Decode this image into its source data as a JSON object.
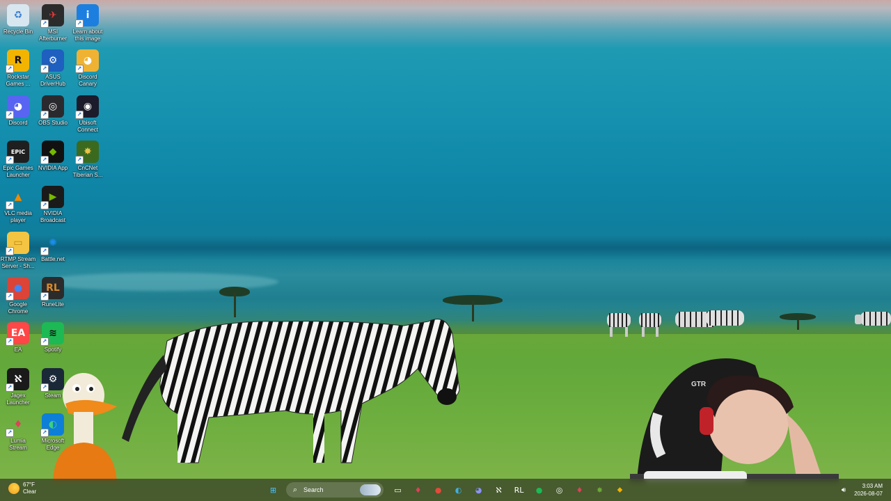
{
  "desktop": {
    "icons": [
      {
        "name": "recycle-bin",
        "label": "Recycle Bin",
        "glyph": "♻",
        "bg": "#d8e6f0",
        "fg": "#3b7fd0"
      },
      {
        "name": "msi-afterburner",
        "label": "MSI\nAfterburner",
        "glyph": "✈",
        "bg": "#2b2b2b",
        "fg": "#e23b3b"
      },
      {
        "name": "learn-about-image",
        "label": "Learn about\nthis image",
        "glyph": "i",
        "bg": "#1c7fe0",
        "fg": "#ffffff"
      },
      {
        "name": "rockstar-games",
        "label": "Rockstar\nGames ...",
        "glyph": "R",
        "bg": "#f2b400",
        "fg": "#111111"
      },
      {
        "name": "asus-driverhub",
        "label": "ASUS\nDriverHub",
        "glyph": "⚙",
        "bg": "#1e5fbf",
        "fg": "#ffffff"
      },
      {
        "name": "discord-canary",
        "label": "Discord\nCanary",
        "glyph": "◕",
        "bg": "#f0b232",
        "fg": "#ffffff"
      },
      {
        "name": "discord",
        "label": "Discord",
        "glyph": "◕",
        "bg": "#5865f2",
        "fg": "#ffffff"
      },
      {
        "name": "obs-studio",
        "label": "OBS Studio",
        "glyph": "◎",
        "bg": "#2a2a2e",
        "fg": "#ffffff"
      },
      {
        "name": "ubisoft-connect",
        "label": "Ubisoft\nConnect",
        "glyph": "◉",
        "bg": "#1b1b2b",
        "fg": "#ffffff"
      },
      {
        "name": "epic-games",
        "label": "Epic Games\nLauncher",
        "glyph": "EPIC",
        "bg": "#1f1f1f",
        "fg": "#ffffff"
      },
      {
        "name": "nvidia-app",
        "label": "NVIDIA App",
        "glyph": "◆",
        "bg": "#111111",
        "fg": "#76b900"
      },
      {
        "name": "cncnet",
        "label": "CnCNet\nTiberian S...",
        "glyph": "✸",
        "bg": "#3b6a1e",
        "fg": "#e8c24a"
      },
      {
        "name": "vlc",
        "label": "VLC media\nplayer",
        "glyph": "▲",
        "bg": "transparent",
        "fg": "#f08a00"
      },
      {
        "name": "nvidia-broadcast",
        "label": "NVIDIA\nBroadcast",
        "glyph": "▶",
        "bg": "#1a1a1a",
        "fg": "#76b900"
      },
      {
        "name": "rtmp-stream",
        "label": "RTMP Stream\nServer - Sh...",
        "glyph": "▭",
        "bg": "#f4c542",
        "fg": "#b88510"
      },
      {
        "name": "battle-net",
        "label": "Battle.net",
        "glyph": "✺",
        "bg": "transparent",
        "fg": "#1b8ef2"
      },
      {
        "name": "google-chrome",
        "label": "Google\nChrome",
        "glyph": "●",
        "bg": "#db4437",
        "fg": "#4285f4"
      },
      {
        "name": "runelite",
        "label": "RuneLite",
        "glyph": "RL",
        "bg": "#2b2b2b",
        "fg": "#d88a2a"
      },
      {
        "name": "ea",
        "label": "EA",
        "glyph": "EA",
        "bg": "#ff4747",
        "fg": "#ffffff"
      },
      {
        "name": "spotify",
        "label": "Spotify",
        "glyph": "≋",
        "bg": "#1db954",
        "fg": "#111111"
      },
      {
        "name": "jagex-launcher",
        "label": "Jagex\nLauncher",
        "glyph": "ℵ",
        "bg": "#1a1a1a",
        "fg": "#ffffff"
      },
      {
        "name": "steam",
        "label": "Steam",
        "glyph": "⚙",
        "bg": "#1b2838",
        "fg": "#ffffff"
      },
      {
        "name": "lumia-stream",
        "label": "Lumia\nStream",
        "glyph": "♦",
        "bg": "transparent",
        "fg": "#e0405a"
      },
      {
        "name": "microsoft-edge",
        "label": "Microsoft\nEdge",
        "glyph": "◐",
        "bg": "#0d7fd8",
        "fg": "#3fd07a"
      }
    ]
  },
  "taskbar": {
    "weather": {
      "temp": "67°F",
      "condition": "Clear"
    },
    "search_placeholder": "Search",
    "apps": [
      {
        "name": "start-button",
        "glyph": "⊞",
        "bg": "transparent",
        "fg": "#4cc2ff"
      },
      {
        "name": "task-view",
        "glyph": "▭",
        "bg": "transparent",
        "fg": "#ffffff"
      },
      {
        "name": "lumia-stream",
        "glyph": "♦",
        "bg": "transparent",
        "fg": "#e0405a"
      },
      {
        "name": "google-chrome",
        "glyph": "●",
        "bg": "transparent",
        "fg": "#e24a3b"
      },
      {
        "name": "microsoft-edge",
        "glyph": "◐",
        "bg": "transparent",
        "fg": "#3fb0e8"
      },
      {
        "name": "discord",
        "glyph": "◕",
        "bg": "transparent",
        "fg": "#8a93ff"
      },
      {
        "name": "jagex-launcher",
        "glyph": "ℵ",
        "bg": "transparent",
        "fg": "#ffffff"
      },
      {
        "name": "runelite",
        "glyph": "RL",
        "bg": "transparent",
        "fg": "#ffffff"
      },
      {
        "name": "spotify",
        "glyph": "●",
        "bg": "transparent",
        "fg": "#1db954"
      },
      {
        "name": "obs-studio",
        "glyph": "◎",
        "bg": "transparent",
        "fg": "#ffffff"
      },
      {
        "name": "lumia-stream-2",
        "glyph": "♦",
        "bg": "transparent",
        "fg": "#e0405a"
      },
      {
        "name": "cncnet",
        "glyph": "✸",
        "bg": "transparent",
        "fg": "#6fa83a"
      },
      {
        "name": "rockstar-games",
        "glyph": "⬥",
        "bg": "transparent",
        "fg": "#f2b400"
      }
    ],
    "clock": {
      "time": "3:03 AM",
      "date": "2026-08-07"
    }
  }
}
